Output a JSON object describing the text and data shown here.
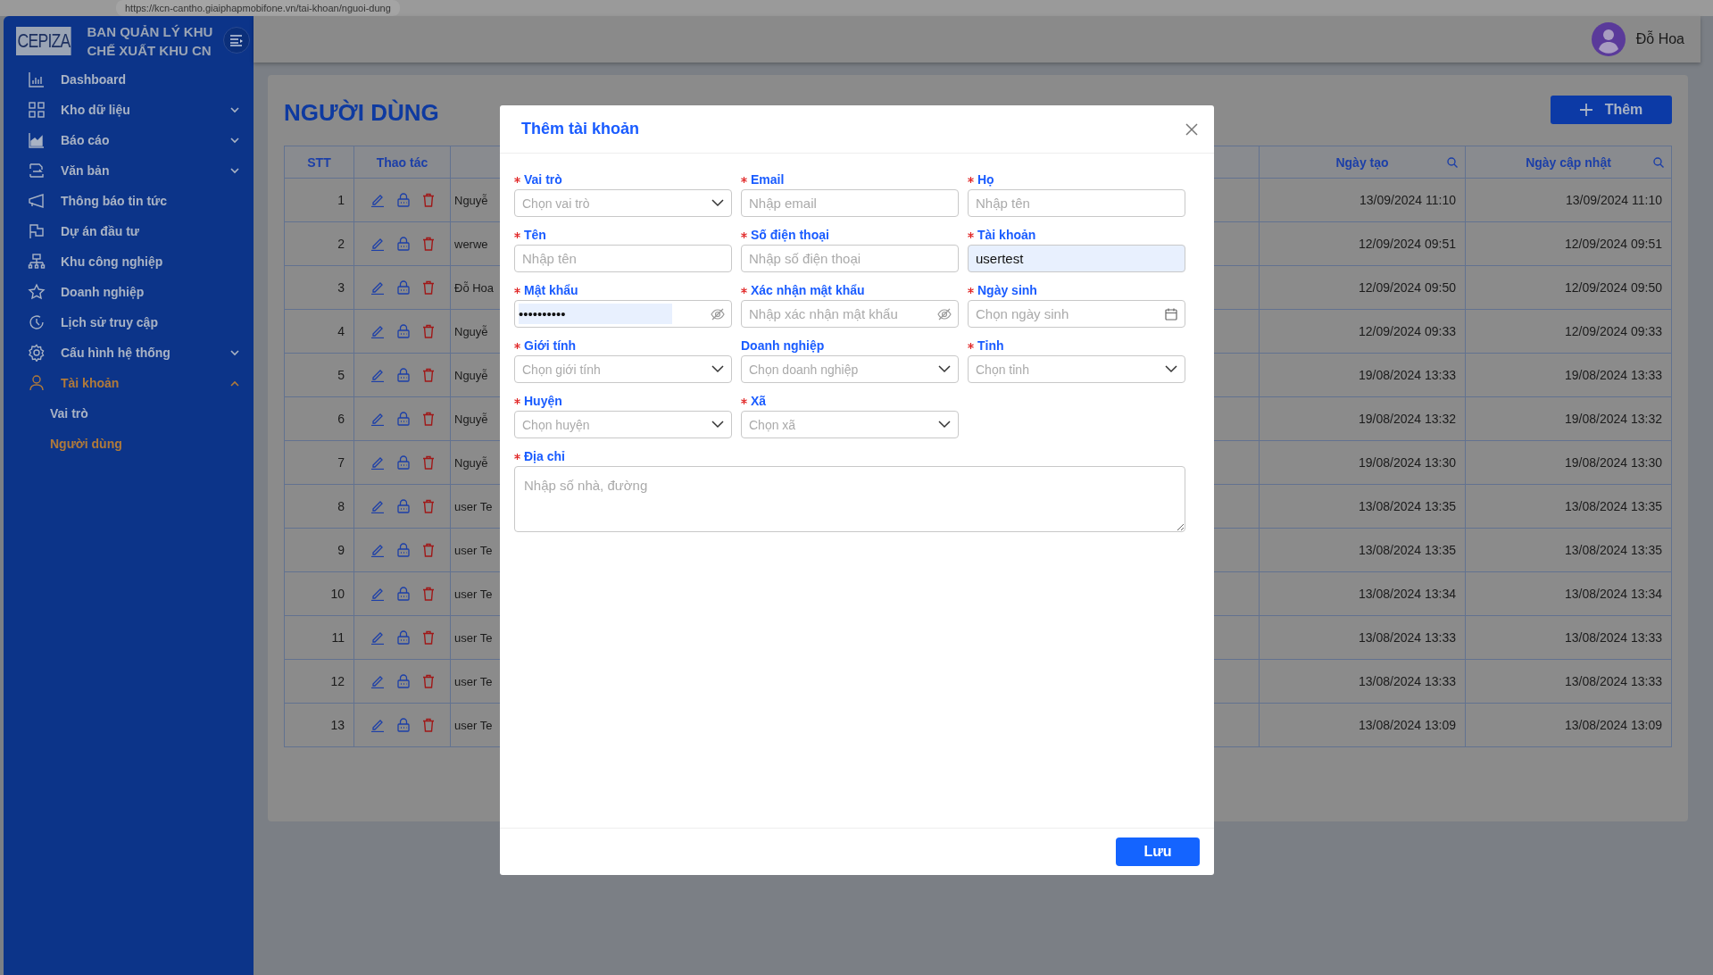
{
  "browser": {
    "url": "https://kcn-cantho.giaiphapmobifone.vn/tai-khoan/nguoi-dung"
  },
  "sidebar": {
    "logo": "CEPIZA",
    "title": [
      "BAN QUẢN LÝ KHU",
      "CHẾ XUẤT KHU CN"
    ],
    "items": [
      {
        "label": "Dashboard",
        "kind": "link",
        "selected": false
      },
      {
        "label": "Kho dữ liệu",
        "kind": "group",
        "expanded": false,
        "selected": false
      },
      {
        "label": "Báo cáo",
        "kind": "group",
        "expanded": false,
        "selected": false
      },
      {
        "label": "Văn bản",
        "kind": "group",
        "expanded": false,
        "selected": false
      },
      {
        "label": "Thông báo tin tức",
        "kind": "link",
        "selected": false
      },
      {
        "label": "Dự án đầu tư",
        "kind": "link",
        "selected": false
      },
      {
        "label": "Khu công nghiệp",
        "kind": "link",
        "selected": false
      },
      {
        "label": "Doanh nghiệp",
        "kind": "link",
        "selected": false
      },
      {
        "label": "Lịch sử truy cập",
        "kind": "link",
        "selected": false
      },
      {
        "label": "Cấu hình hệ thống",
        "kind": "group",
        "expanded": false,
        "selected": false
      },
      {
        "label": "Tài khoản",
        "kind": "group",
        "expanded": true,
        "selected": true,
        "children": [
          {
            "label": "Vai trò",
            "selected": false
          },
          {
            "label": "Người dùng",
            "selected": true
          }
        ]
      }
    ]
  },
  "header": {
    "user_name": "Đỗ Hoa"
  },
  "page": {
    "title": "NGƯỜI DÙNG",
    "add_button": "Thêm"
  },
  "table": {
    "columns": [
      {
        "label": "STT",
        "searchable": false
      },
      {
        "label": "Thao tác",
        "searchable": false
      },
      {
        "label": "Ngày tạo",
        "searchable": true
      },
      {
        "label": "Ngày cập nhật",
        "searchable": true
      }
    ],
    "rows": [
      {
        "stt": "1",
        "name": "Nguyễ",
        "created": "13/09/2024 11:10",
        "updated": "13/09/2024 11:10"
      },
      {
        "stt": "2",
        "name": "werwe",
        "created": "12/09/2024 09:51",
        "updated": "12/09/2024 09:51"
      },
      {
        "stt": "3",
        "name": "Đỗ Hoa",
        "created": "12/09/2024 09:50",
        "updated": "12/09/2024 09:50"
      },
      {
        "stt": "4",
        "name": "Nguyễ",
        "created": "12/09/2024 09:33",
        "updated": "12/09/2024 09:33"
      },
      {
        "stt": "5",
        "name": "Nguyễ",
        "created": "19/08/2024 13:33",
        "updated": "19/08/2024 13:33"
      },
      {
        "stt": "6",
        "name": "Nguyễ",
        "created": "19/08/2024 13:32",
        "updated": "19/08/2024 13:32"
      },
      {
        "stt": "7",
        "name": "Nguyễ",
        "created": "19/08/2024 13:30",
        "updated": "19/08/2024 13:30"
      },
      {
        "stt": "8",
        "name": "user Te",
        "created": "13/08/2024 13:35",
        "updated": "13/08/2024 13:35"
      },
      {
        "stt": "9",
        "name": "user Te",
        "created": "13/08/2024 13:35",
        "updated": "13/08/2024 13:35"
      },
      {
        "stt": "10",
        "name": "user Te",
        "created": "13/08/2024 13:34",
        "updated": "13/08/2024 13:34"
      },
      {
        "stt": "11",
        "name": "user Te",
        "created": "13/08/2024 13:33",
        "updated": "13/08/2024 13:33"
      },
      {
        "stt": "12",
        "name": "user Te",
        "created": "13/08/2024 13:33",
        "updated": "13/08/2024 13:33"
      },
      {
        "stt": "13",
        "name": "user Te",
        "created": "13/08/2024 13:09",
        "updated": "13/08/2024 13:09"
      }
    ]
  },
  "modal": {
    "title": "Thêm tài khoản",
    "save_button": "Lưu",
    "fields": [
      {
        "label": "Vai trò",
        "required": true,
        "kind": "select",
        "placeholder": "Chọn vai trò"
      },
      {
        "label": "Email",
        "required": true,
        "kind": "text",
        "placeholder": "Nhập email"
      },
      {
        "label": "Họ",
        "required": true,
        "kind": "text",
        "placeholder": "Nhập tên"
      },
      {
        "label": "Tên",
        "required": true,
        "kind": "text",
        "placeholder": "Nhập tên"
      },
      {
        "label": "Số điện thoại",
        "required": true,
        "kind": "text",
        "placeholder": "Nhập số điện thoại"
      },
      {
        "label": "Tài khoản",
        "required": true,
        "kind": "text",
        "value": "usertest",
        "autofilled": true
      },
      {
        "label": "Mật khẩu",
        "required": true,
        "kind": "password",
        "value": "••••••••••",
        "autofilled": true
      },
      {
        "label": "Xác nhận mật khẩu",
        "required": true,
        "kind": "password",
        "placeholder": "Nhập xác nhận mật khẩu",
        "autofilled": false
      },
      {
        "label": "Ngày sinh",
        "required": true,
        "kind": "date",
        "placeholder": "Chọn ngày sinh"
      },
      {
        "label": "Giới tính",
        "required": true,
        "kind": "select",
        "placeholder": "Chọn giới tính"
      },
      {
        "label": "Doanh nghiệp",
        "required": false,
        "kind": "select",
        "placeholder": "Chọn doanh nghiệp"
      },
      {
        "label": "Tỉnh",
        "required": true,
        "kind": "select",
        "placeholder": "Chọn tỉnh"
      },
      {
        "label": "Huyện",
        "required": true,
        "kind": "select",
        "placeholder": "Chọn huyện"
      },
      {
        "label": "Xã",
        "required": true,
        "kind": "select",
        "placeholder": "Chọn xã"
      },
      {
        "label": "Địa chỉ",
        "required": true,
        "kind": "textarea",
        "placeholder": "Nhập số nhà, đường"
      }
    ]
  }
}
